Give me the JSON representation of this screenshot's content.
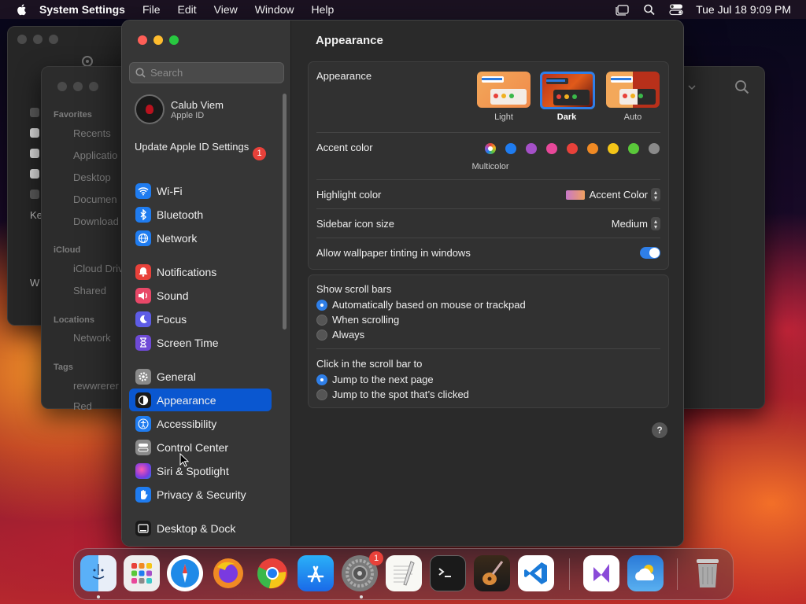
{
  "menubar": {
    "app_name": "System Settings",
    "items": [
      "File",
      "Edit",
      "View",
      "Window",
      "Help"
    ],
    "datetime": "Tue Jul 18  9:09 PM"
  },
  "finder_bg": {
    "favorites_head": "Favorites",
    "favorites": [
      "Recents",
      "Applicatio",
      "Desktop",
      "Documen",
      "Download"
    ],
    "icloud_head": "iCloud",
    "icloud": [
      "iCloud Driv",
      "Shared"
    ],
    "locations_head": "Locations",
    "locations": [
      "Network"
    ],
    "tags_head": "Tags",
    "tags": [
      "rewwrerer",
      "Red"
    ],
    "side_letters": [
      "Ke",
      "W"
    ]
  },
  "sidebar": {
    "search_placeholder": "Search",
    "profile": {
      "name": "Calub Viem",
      "subtitle": "Apple ID"
    },
    "update": {
      "label": "Update Apple ID Settings",
      "badge": "1"
    },
    "items": [
      {
        "label": "Wi-Fi",
        "icon": "wifi-icon",
        "color": "#1f7cf0"
      },
      {
        "label": "Bluetooth",
        "icon": "bluetooth-icon",
        "color": "#1f7cf0"
      },
      {
        "label": "Network",
        "icon": "globe-icon",
        "color": "#1f7cf0"
      },
      {
        "label": "Notifications",
        "icon": "bell-icon",
        "color": "#e8413a"
      },
      {
        "label": "Sound",
        "icon": "speaker-icon",
        "color": "#e84868"
      },
      {
        "label": "Focus",
        "icon": "moon-icon",
        "color": "#5e5ce6"
      },
      {
        "label": "Screen Time",
        "icon": "hourglass-icon",
        "color": "#6e4ad6"
      },
      {
        "label": "General",
        "icon": "gear-icon",
        "color": "#8a8a8a"
      },
      {
        "label": "Appearance",
        "icon": "appearance-icon",
        "color": "#1a1a1a"
      },
      {
        "label": "Accessibility",
        "icon": "accessibility-icon",
        "color": "#1f7cf0"
      },
      {
        "label": "Control Center",
        "icon": "control-center-icon",
        "color": "#8a8a8a"
      },
      {
        "label": "Siri & Spotlight",
        "icon": "siri-icon",
        "color": "#b03ad0"
      },
      {
        "label": "Privacy & Security",
        "icon": "hand-icon",
        "color": "#1f7cf0"
      },
      {
        "label": "Desktop & Dock",
        "icon": "dock-icon",
        "color": "#1a1a1a"
      }
    ],
    "active": "Appearance"
  },
  "content": {
    "title": "Appearance",
    "appearance": {
      "label": "Appearance",
      "options": [
        "Light",
        "Dark",
        "Auto"
      ],
      "selected": "Dark"
    },
    "accent": {
      "label": "Accent color",
      "multicolor_label": "Multicolor",
      "colors": [
        "#1f7cf0",
        "#a550c8",
        "#e8489a",
        "#e8413a",
        "#f08a24",
        "#f4c518",
        "#5ac83a",
        "#8a8a8a"
      ]
    },
    "highlight": {
      "label": "Highlight color",
      "value": "Accent Color"
    },
    "sidebar_icon": {
      "label": "Sidebar icon size",
      "value": "Medium"
    },
    "wallpaper_tint": {
      "label": "Allow wallpaper tinting in windows",
      "on": true
    },
    "scroll_bars": {
      "label": "Show scroll bars",
      "options": [
        "Automatically based on mouse or trackpad",
        "When scrolling",
        "Always"
      ],
      "selected": 0
    },
    "scroll_click": {
      "label": "Click in the scroll bar to",
      "options": [
        "Jump to the next page",
        "Jump to the spot that’s clicked"
      ],
      "selected": 0
    },
    "help": "?"
  },
  "dock": {
    "apps": [
      "finder-icon",
      "launchpad-icon",
      "safari-icon",
      "firefox-icon",
      "chrome-icon",
      "app-store-icon",
      "system-settings-icon",
      "textedit-icon",
      "terminal-icon",
      "garageband-icon",
      "vscode-icon",
      "visual-studio-icon",
      "weather-icon",
      "trash-icon"
    ],
    "settings_badge": "1"
  }
}
